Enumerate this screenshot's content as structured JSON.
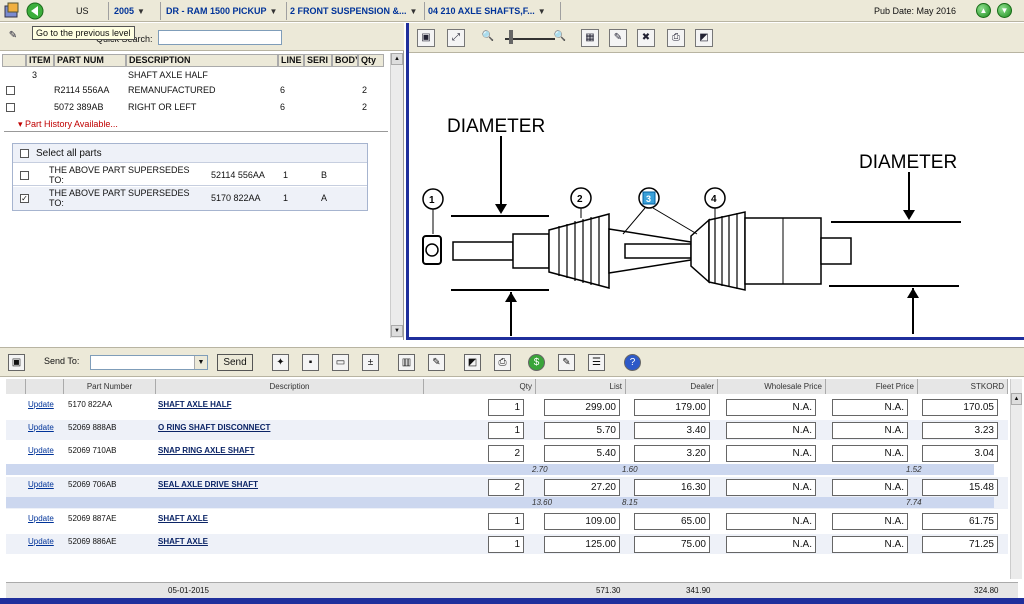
{
  "topbar": {
    "country": "US",
    "year": "2005",
    "model": "DR - RAM 1500 PICKUP",
    "group": "2 FRONT SUSPENSION &...",
    "subgroup": "04 210 AXLE SHAFTS,F...",
    "pub_date": "Pub Date: May 2016",
    "tooltip": "Go to the previous level"
  },
  "parts_list": {
    "quick_search_label": "Quick Search:",
    "quick_search_value": "",
    "headers": [
      "ITEM",
      "PART NUM",
      "DESCRIPTION",
      "LINE",
      "SERI",
      "BODY",
      "Qty"
    ],
    "rows": [
      {
        "item": "3",
        "part": "",
        "desc": "SHAFT AXLE HALF",
        "line": "",
        "qty": ""
      },
      {
        "item": "",
        "part": "R2114 556AA",
        "desc": "REMANUFACTURED",
        "line": "6",
        "qty": "2"
      },
      {
        "item": "",
        "part": "5072 389AB",
        "desc": "RIGHT OR LEFT",
        "line": "6",
        "qty": "2"
      }
    ],
    "history_link": "Part History Available...",
    "select_all": "Select all parts",
    "supersedes": [
      {
        "text": "THE ABOVE PART SUPERSEDES TO:",
        "part": "52114 556AA",
        "num": "1",
        "code": "B",
        "checked": false
      },
      {
        "text": "THE ABOVE PART SUPERSEDES TO:",
        "part": "5170 822AA",
        "num": "1",
        "code": "A",
        "checked": true
      }
    ]
  },
  "diagram": {
    "label_left": "DIAMETER",
    "label_right": "DIAMETER",
    "callouts": [
      "1",
      "2",
      "3",
      "4"
    ]
  },
  "order": {
    "send_to_label": "Send To:",
    "send_to_value": "",
    "send_button": "Send",
    "columns": [
      "Part Number",
      "Description",
      "Qty",
      "List",
      "Dealer",
      "Wholesale Price",
      "Fleet Price",
      "STKORD"
    ],
    "update_label": "Update",
    "rows": [
      {
        "part": "5170 822AA",
        "desc": "SHAFT AXLE HALF",
        "qty": "1",
        "list": "299.00",
        "dealer": "179.00",
        "wholesale": "N.A.",
        "fleet": "N.A.",
        "stk": "170.05"
      },
      {
        "part": "52069 888AB",
        "desc": "O RING SHAFT DISCONNECT",
        "qty": "1",
        "list": "5.70",
        "dealer": "3.40",
        "wholesale": "N.A.",
        "fleet": "N.A.",
        "stk": "3.23"
      },
      {
        "part": "52069 710AB",
        "desc": "SNAP RING AXLE SHAFT",
        "qty": "2",
        "list": "5.40",
        "dealer": "3.20",
        "wholesale": "N.A.",
        "fleet": "N.A.",
        "stk": "3.04",
        "sub": {
          "list": "2.70",
          "dealer": "1.60",
          "stk": "1.52"
        }
      },
      {
        "part": "52069 706AB",
        "desc": "SEAL AXLE DRIVE SHAFT",
        "qty": "2",
        "list": "27.20",
        "dealer": "16.30",
        "wholesale": "N.A.",
        "fleet": "N.A.",
        "stk": "15.48",
        "sub": {
          "list": "13.60",
          "dealer": "8.15",
          "stk": "7.74"
        }
      },
      {
        "part": "52069 887AE",
        "desc": "SHAFT AXLE",
        "qty": "1",
        "list": "109.00",
        "dealer": "65.00",
        "wholesale": "N.A.",
        "fleet": "N.A.",
        "stk": "61.75"
      },
      {
        "part": "52069 886AE",
        "desc": "SHAFT AXLE",
        "qty": "1",
        "list": "125.00",
        "dealer": "75.00",
        "wholesale": "N.A.",
        "fleet": "N.A.",
        "stk": "71.25"
      }
    ],
    "footer": {
      "date": "05-01-2015",
      "list_total": "571.30",
      "dealer_total": "341.90",
      "stk_total": "324.80"
    }
  },
  "colors": {
    "accent": "#1f2f9c",
    "link": "#003399",
    "history": "#c00000",
    "price_band": "#ccd7ef"
  }
}
